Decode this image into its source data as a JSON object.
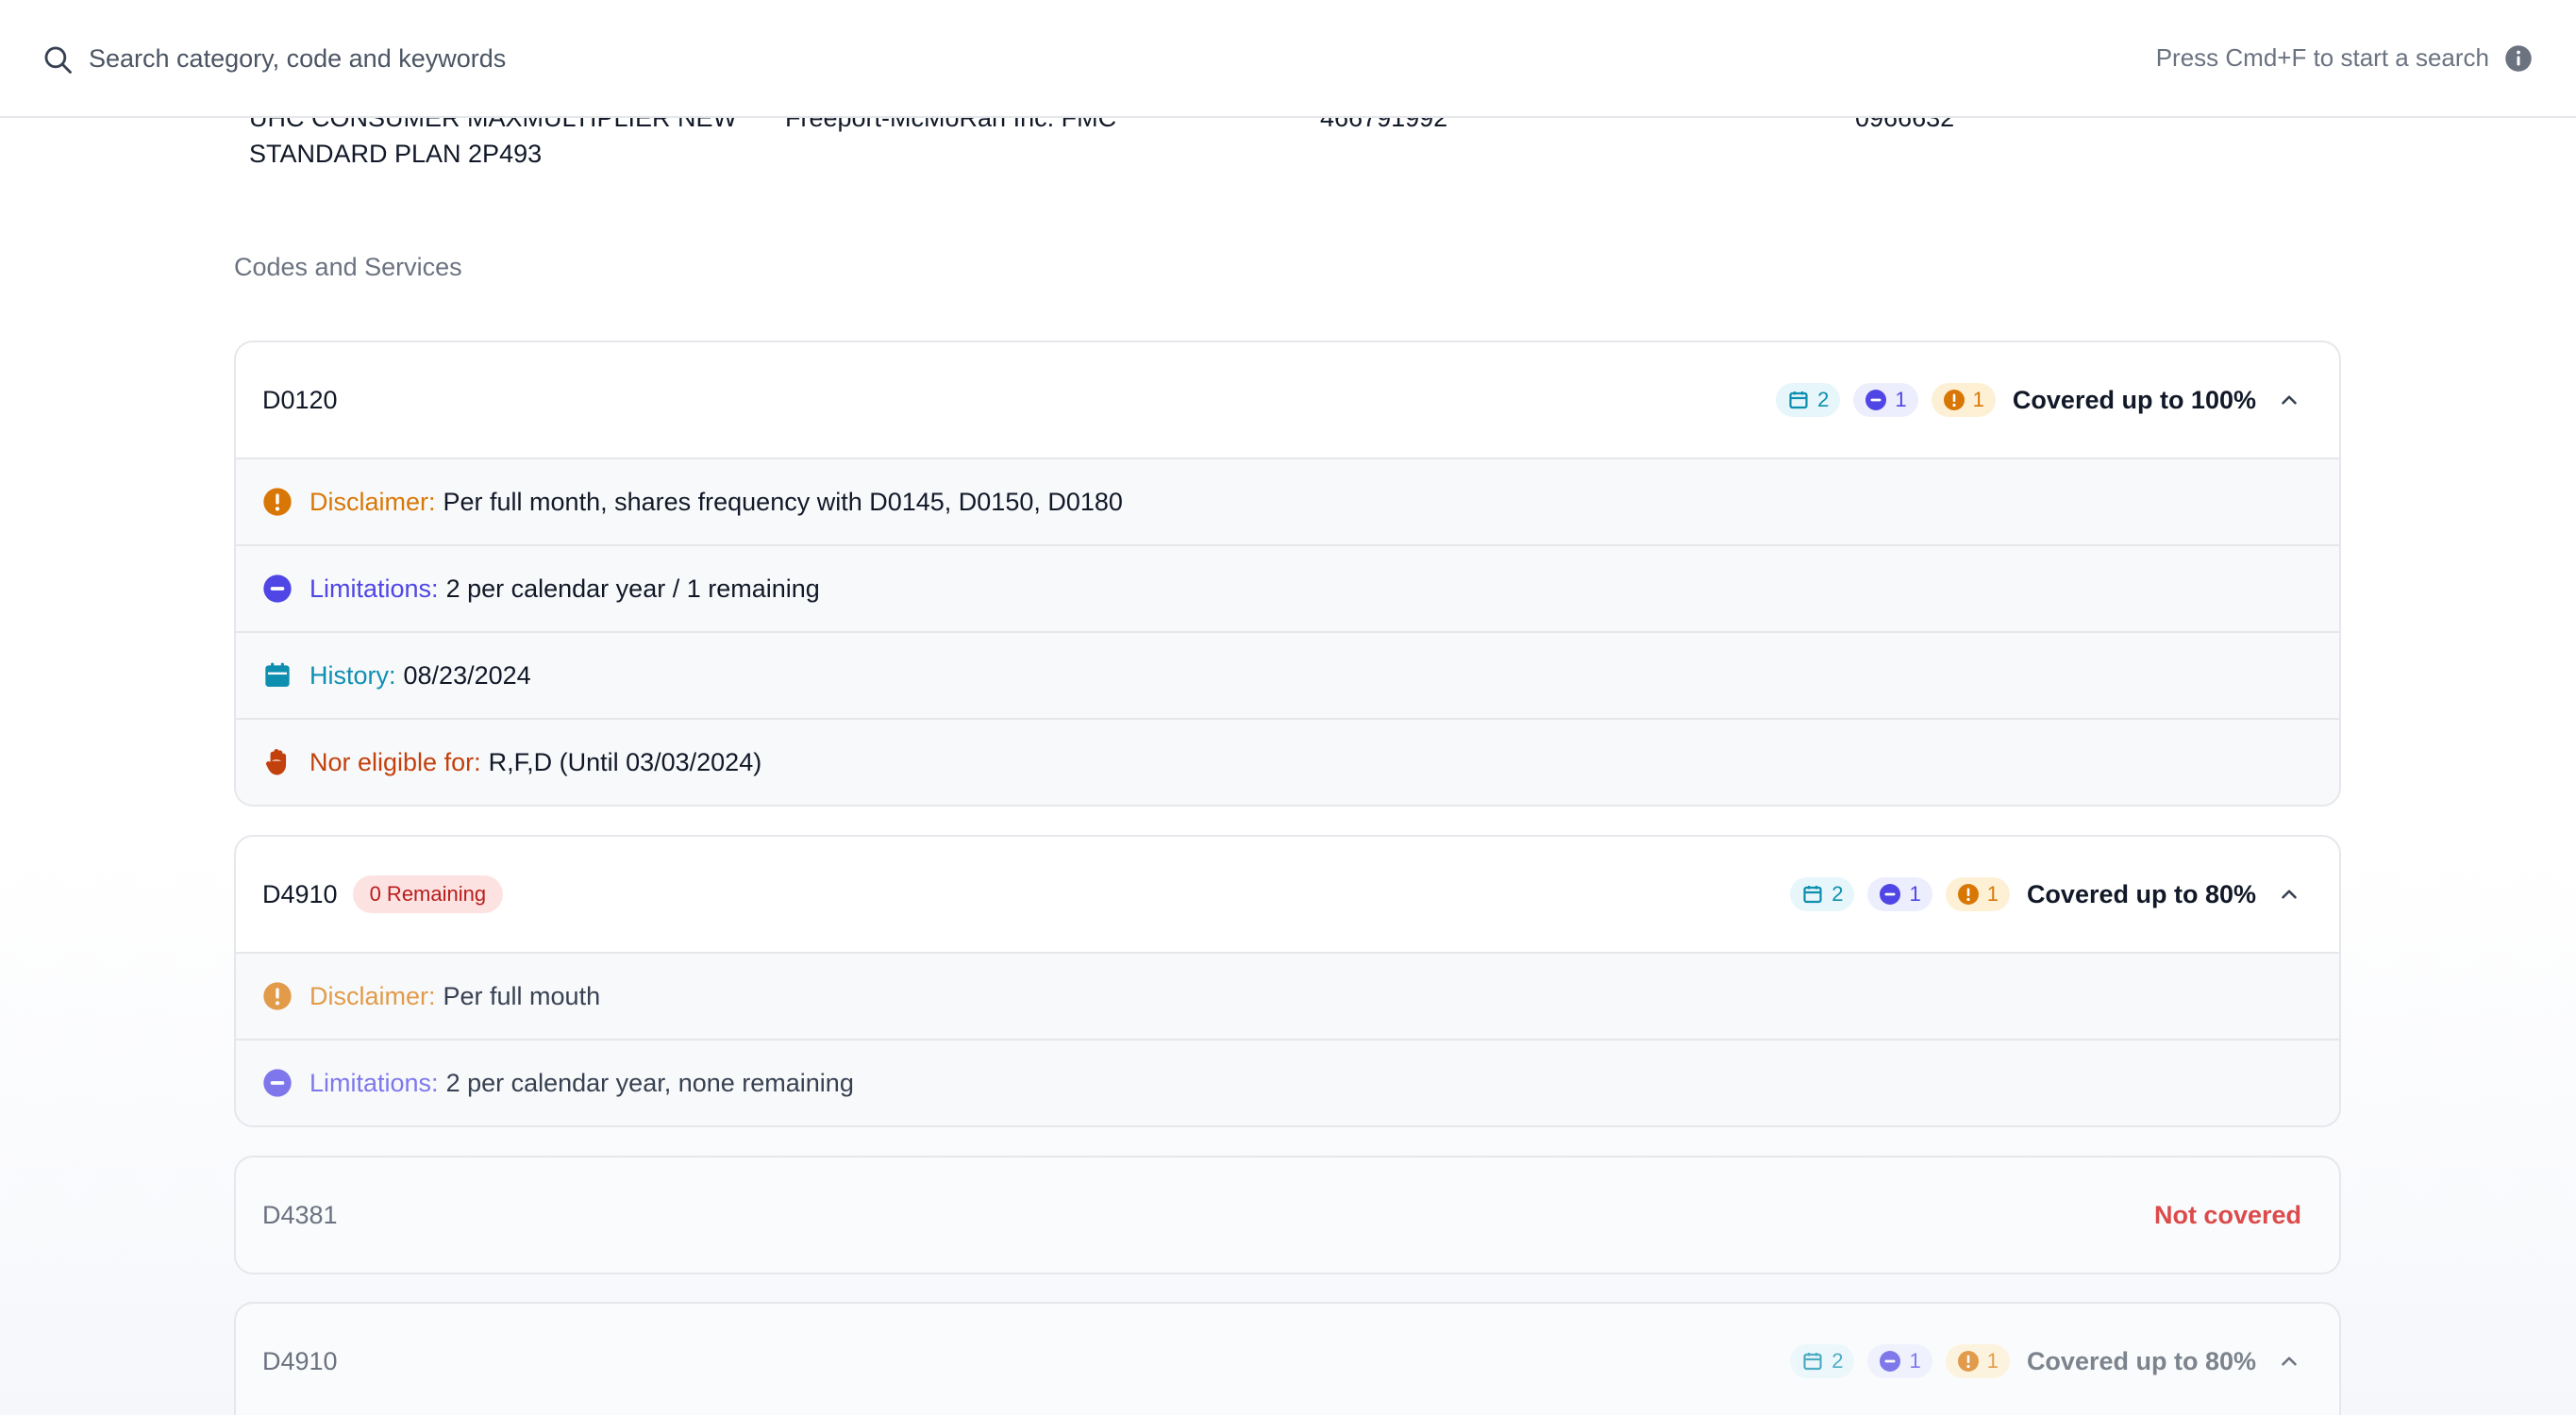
{
  "search": {
    "placeholder": "Search category, code and keywords",
    "hint": "Press Cmd+F to start a search"
  },
  "plan": {
    "name_line1": "UHC CONSUMER MAXMULTIPLIER NEW",
    "name_line2": "STANDARD PLAN 2P493",
    "employer": "Freeport-McMoRan Inc. FMC",
    "group_number": "466791992",
    "member_id": "0966632"
  },
  "section_title": "Codes and Services",
  "colors": {
    "disclaimer": "#d97706",
    "limitations": "#4f46e5",
    "history": "#0e8fb0",
    "not_eligible": "#c2410c",
    "not_covered": "#dc4b4b"
  },
  "cards": [
    {
      "code": "D0120",
      "counts": {
        "history": "2",
        "limitations": "1",
        "disclaimer": "1"
      },
      "coverage": "Covered up to 100%",
      "details": [
        {
          "label": "Disclaimer:",
          "value": "Per full month, shares frequency with D0145, D0150, D0180"
        },
        {
          "label": "Limitations:",
          "value": "2 per calendar year / 1 remaining"
        },
        {
          "label": "History:",
          "value": "08/23/2024"
        },
        {
          "label": "Nor eligible for:",
          "value": "R,F,D (Until 03/03/2024)"
        }
      ]
    },
    {
      "code": "D4910",
      "badge": "0 Remaining",
      "counts": {
        "history": "2",
        "limitations": "1",
        "disclaimer": "1"
      },
      "coverage": "Covered up to 80%",
      "details": [
        {
          "label": "Disclaimer:",
          "value": "Per full mouth"
        },
        {
          "label": "Limitations:",
          "value": "2 per calendar year, none remaining"
        }
      ]
    },
    {
      "code": "D4381",
      "coverage": "Not covered"
    },
    {
      "code": "D4910",
      "counts": {
        "history": "2",
        "limitations": "1",
        "disclaimer": "1"
      },
      "coverage": "Covered up to 80%"
    }
  ]
}
